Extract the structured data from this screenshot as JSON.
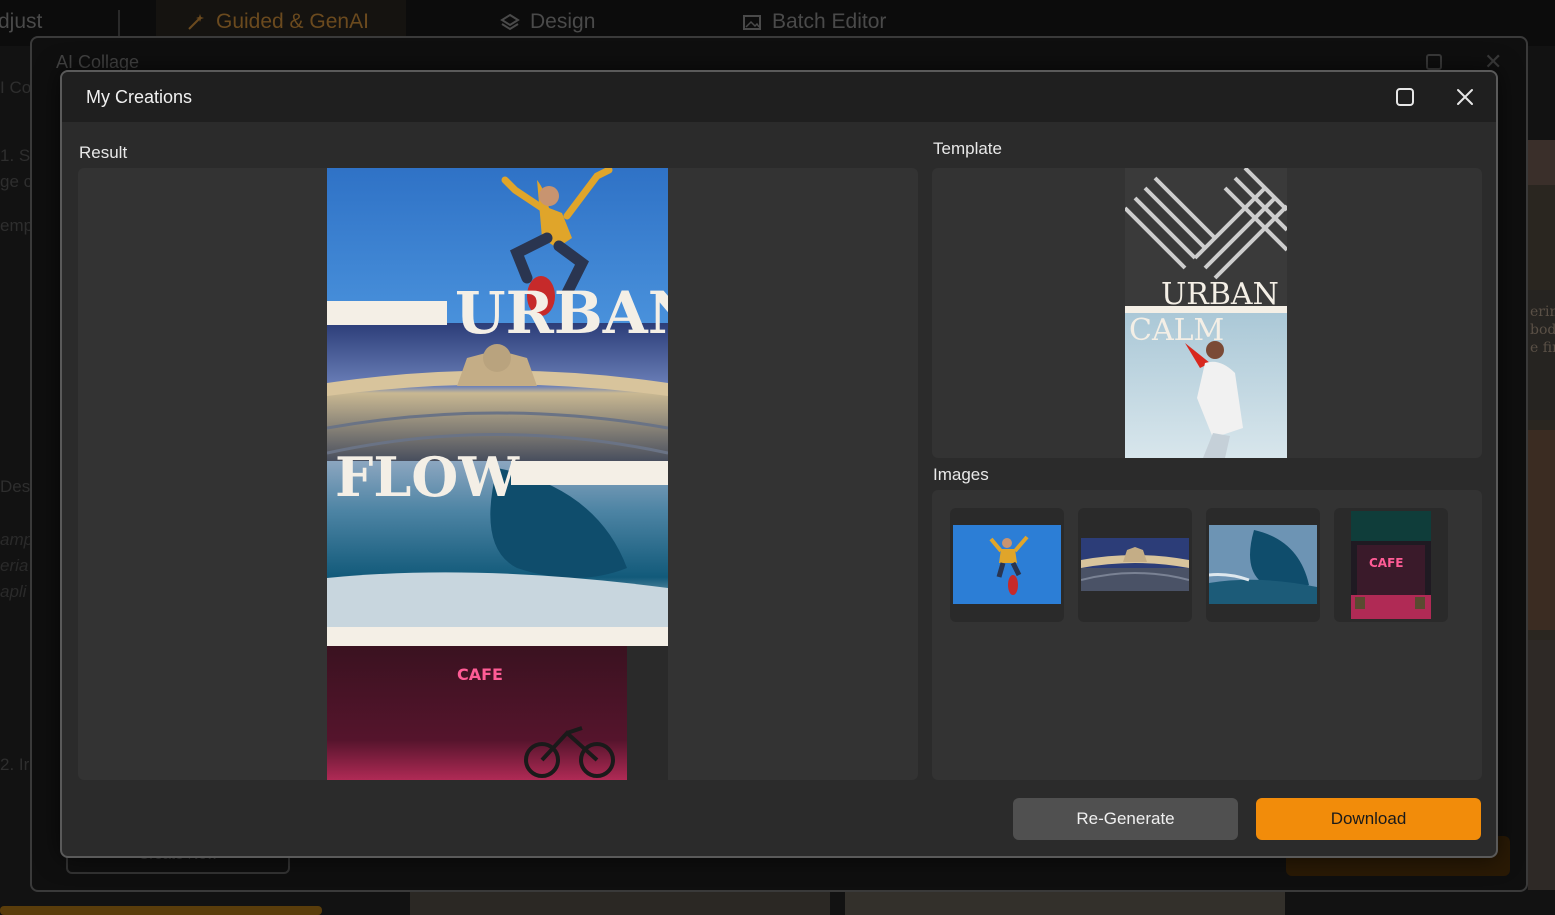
{
  "background": {
    "tabs": [
      {
        "label": "djust",
        "icon": "none"
      },
      {
        "label": "Guided & GenAI",
        "icon": "magic-wand-icon"
      },
      {
        "label": "Design",
        "icon": "layers-icon"
      },
      {
        "label": "Batch Editor",
        "icon": "images-icon"
      }
    ],
    "dialog_title": "AI Collage",
    "left_fragments": [
      "I Co",
      "1. S",
      "ge c",
      "emp",
      "Desc",
      "amp",
      "eria",
      "apli",
      "2. Ir"
    ],
    "create_button": "Create New",
    "right_fragments": [
      "erin",
      "bod",
      "e fir"
    ]
  },
  "modal": {
    "title": "My Creations",
    "result_label": "Result",
    "template_label": "Template",
    "images_label": "Images",
    "result_collage": {
      "headline_1": "URBAN",
      "headline_2": "FLOW",
      "sign_text": "CAFE"
    },
    "template_preview": {
      "headline_1": "URBAN",
      "headline_2": "CALM"
    },
    "thumbnail_sign_text": "CAFE",
    "buttons": {
      "regenerate": "Re-Generate",
      "download": "Download"
    }
  },
  "colors": {
    "accent": "#f28c0a",
    "modal_bg": "#2b2b2b",
    "panel_bg": "#333333",
    "titlebar_bg": "#1f1f1f"
  }
}
